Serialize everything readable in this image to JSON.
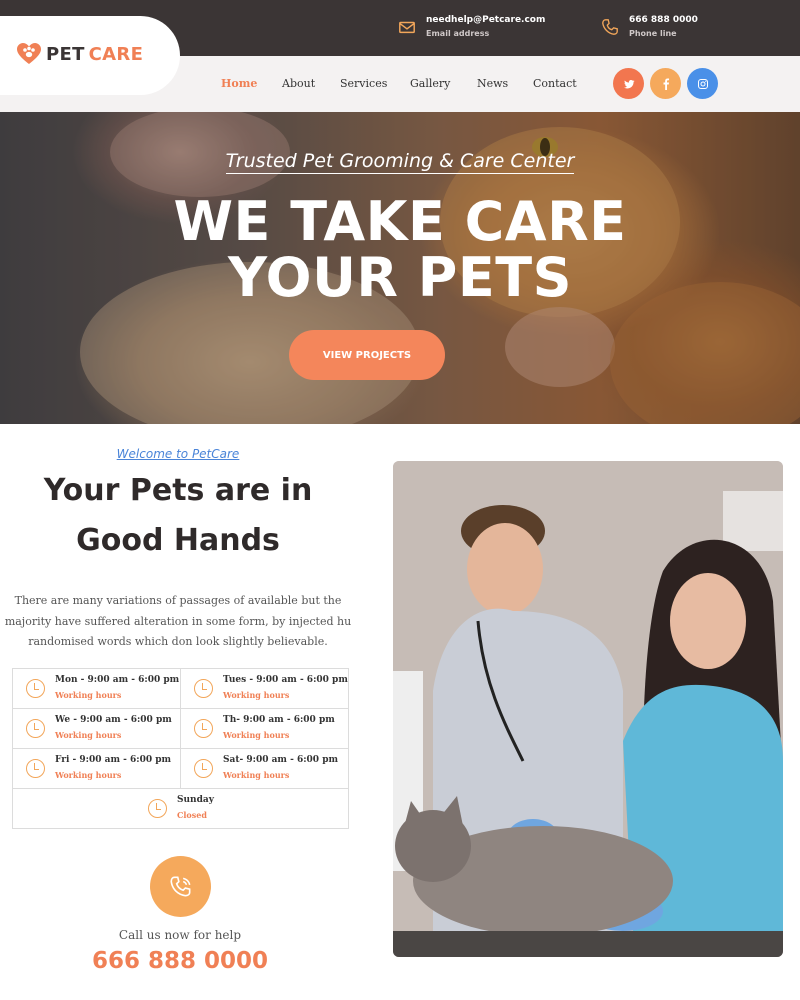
{
  "header": {
    "email": {
      "value": "needhelp@Petcare.com",
      "label": "Email address",
      "icon": "envelope-icon"
    },
    "phone": {
      "value": "666 888 0000",
      "label": "Phone line",
      "icon": "phone-icon"
    }
  },
  "brand": {
    "part1": "PET",
    "part2": "CARE",
    "icon": "heart-paw-icon",
    "colors": {
      "dark": "#3b3535",
      "accent": "#f08055"
    }
  },
  "nav": {
    "items": [
      {
        "label": "Home",
        "active": true
      },
      {
        "label": "About"
      },
      {
        "label": "Services"
      },
      {
        "label": "Gallery"
      },
      {
        "label": "News"
      },
      {
        "label": "Contact"
      }
    ]
  },
  "social": [
    {
      "name": "twitter-icon",
      "glyph": "t",
      "color": "#f2764f"
    },
    {
      "name": "facebook-icon",
      "glyph": "f",
      "color": "#f5a95c"
    },
    {
      "name": "instagram-icon",
      "glyph": "◎",
      "color": "#4a90e8"
    }
  ],
  "hero": {
    "subtitle": "Trusted Pet Grooming & Care Center",
    "title_line1": "WE TAKE CARE",
    "title_line2": "YOUR PETS",
    "button": "VIEW PROJECTS"
  },
  "about": {
    "welcome": "Welcome to PetCare",
    "heading_line1": "Your Pets are in",
    "heading_line2": "Good Hands",
    "paragraph": "There are many variations of passages of available but the majority have suffered alteration in some form, by injected hu randomised words which don look slightly believable."
  },
  "hours": [
    {
      "day": "Mon -  9:00 am - 6:00 pm",
      "status": "Working hours"
    },
    {
      "day": "Tues -  9:00 am - 6:00 pm",
      "status": "Working hours"
    },
    {
      "day": "We -  9:00 am - 6:00 pm",
      "status": "Working hours"
    },
    {
      "day": "Th-  9:00 am - 6:00 pm",
      "status": "Working hours"
    },
    {
      "day": "Fri -  9:00 am - 6:00 pm",
      "status": "Working hours"
    },
    {
      "day": "Sat-  9:00 am - 6:00 pm",
      "status": "Working hours"
    },
    {
      "day": "Sunday",
      "status": "Closed"
    }
  ],
  "call": {
    "label": "Call us now for help",
    "number": "666 888 0000",
    "icon": "phone-call-icon"
  },
  "photo": {
    "subject": "veterinarians-with-cat-photo"
  }
}
